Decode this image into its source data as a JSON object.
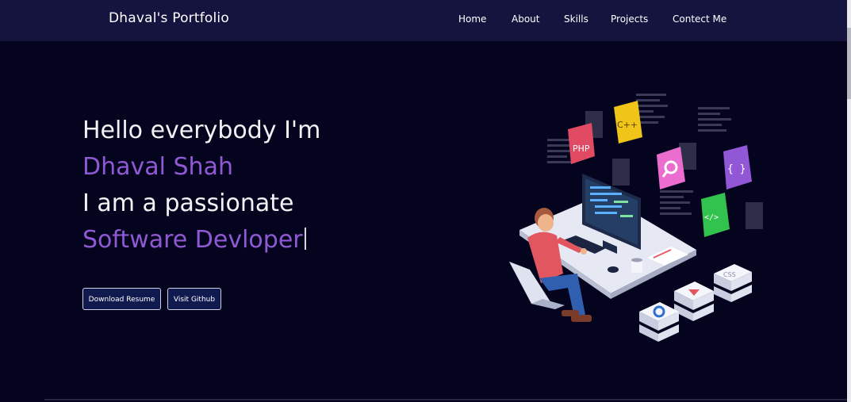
{
  "navbar": {
    "brand": "Dhaval's Portfolio",
    "links": [
      "Home",
      "About",
      "Skills",
      "Projects",
      "Contect Me"
    ]
  },
  "hero": {
    "greeting": "Hello everybody I'm",
    "name": "Dhaval Shah",
    "intro": "I am a passionate",
    "role": "Software Devloper",
    "buttons": {
      "resume": "Download Resume",
      "github": "Visit Github"
    }
  },
  "illustration": {
    "badges": [
      "PHP",
      "C++",
      "{ }",
      "</>",
      "CSS"
    ],
    "icons": [
      "search-icon",
      "play-icon",
      "gear-icon"
    ]
  },
  "colors": {
    "background": "#05041f",
    "navbar": "#14143f",
    "accent_purple": "#8f59d3",
    "text": "#ffffff"
  }
}
